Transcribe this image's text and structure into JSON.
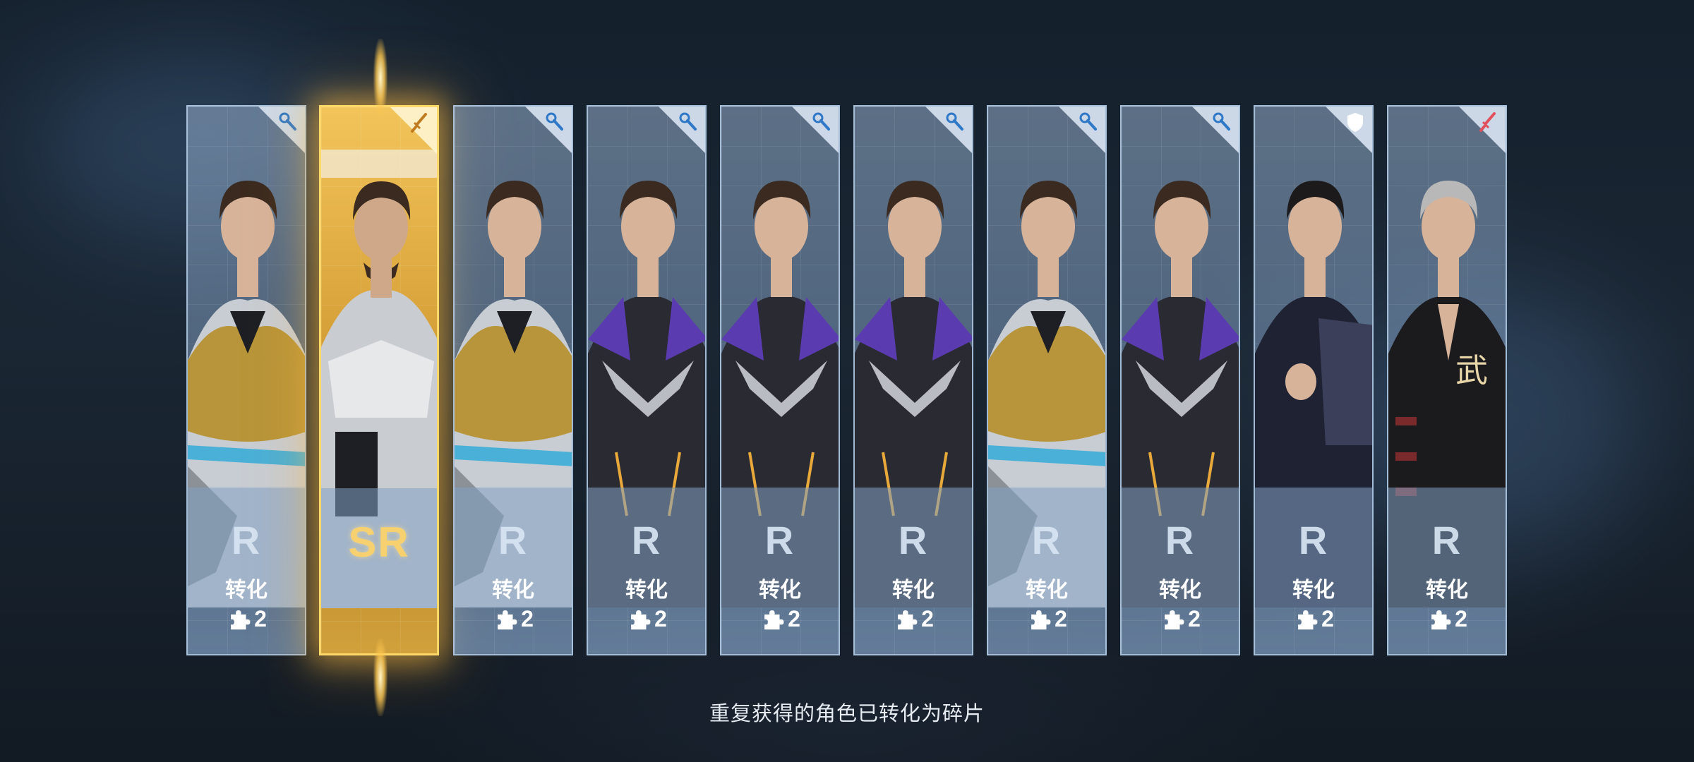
{
  "caption": "重复获得的角色已转化为碎片",
  "cards": [
    {
      "rarity": "R",
      "convert": "转化",
      "fragments": "2",
      "role_icon": "wrench-icon",
      "character": "character-gold-jacket"
    },
    {
      "rarity": "SR",
      "convert": "",
      "fragments": "",
      "role_icon": "sword-icon",
      "character": "character-armored-beard"
    },
    {
      "rarity": "R",
      "convert": "转化",
      "fragments": "2",
      "role_icon": "wrench-icon",
      "character": "character-gold-jacket"
    },
    {
      "rarity": "R",
      "convert": "转化",
      "fragments": "2",
      "role_icon": "wrench-icon",
      "character": "character-purple-suit"
    },
    {
      "rarity": "R",
      "convert": "转化",
      "fragments": "2",
      "role_icon": "wrench-icon",
      "character": "character-purple-suit"
    },
    {
      "rarity": "R",
      "convert": "转化",
      "fragments": "2",
      "role_icon": "wrench-icon",
      "character": "character-purple-suit"
    },
    {
      "rarity": "R",
      "convert": "转化",
      "fragments": "2",
      "role_icon": "wrench-icon",
      "character": "character-gold-jacket"
    },
    {
      "rarity": "R",
      "convert": "转化",
      "fragments": "2",
      "role_icon": "wrench-icon",
      "character": "character-purple-suit"
    },
    {
      "rarity": "R",
      "convert": "转化",
      "fragments": "2",
      "role_icon": "shield-icon",
      "character": "character-dark-shirt"
    },
    {
      "rarity": "R",
      "convert": "转化",
      "fragments": "2",
      "role_icon": "sword-icon",
      "character": "character-martial-silver"
    }
  ],
  "colors": {
    "sr_gold": "#f2c45a",
    "r_panel": "#8fa7c2",
    "accent_red": "#e0505a",
    "accent_blue": "#2f78c8"
  }
}
